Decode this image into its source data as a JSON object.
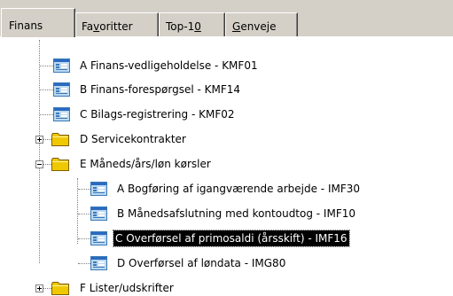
{
  "tabs": [
    {
      "label_parts": [
        "Finans"
      ],
      "active": true
    },
    {
      "label_parts": [
        "Fa",
        "v",
        "oritter"
      ],
      "active": false
    },
    {
      "label_parts": [
        "Top-1",
        "0",
        ""
      ],
      "active": false
    },
    {
      "label_parts": [
        "",
        "G",
        "enveje"
      ],
      "active": false
    }
  ],
  "tree": {
    "items": [
      {
        "label": "A Finans-vedligeholdelse - KMF01",
        "type": "program",
        "level": 0
      },
      {
        "label": "B Finans-forespørgsel - KMF14",
        "type": "program",
        "level": 0
      },
      {
        "label": "C Bilags-registrering - KMF02",
        "type": "program",
        "level": 0
      },
      {
        "label": "D Servicekontrakter",
        "type": "folder",
        "level": 0,
        "expanded": false
      },
      {
        "label": "E Måneds/års/løn kørsler",
        "type": "folder",
        "level": 0,
        "expanded": true
      },
      {
        "label": "A Bogføring af igangværende arbejde - IMF30",
        "type": "program",
        "level": 1
      },
      {
        "label": "B Månedsafslutning med kontoudtog - IMF10",
        "type": "program",
        "level": 1
      },
      {
        "label": "C Overførsel af primosaldi (årsskift) - IMF16",
        "type": "program",
        "level": 1,
        "selected": true
      },
      {
        "label": "D Overførsel af løndata - IMG80",
        "type": "program",
        "level": 1
      },
      {
        "label": "F Lister/udskrifter",
        "type": "folder",
        "level": 0,
        "expanded": false
      }
    ]
  },
  "colors": {
    "window_bg": "#d4d0c8",
    "panel_bg": "#ffffff",
    "folder": "#f0c800",
    "selection_bg": "#000000",
    "selection_fg": "#ffffff"
  },
  "icons": {
    "program": "program-window-icon",
    "folder": "folder-icon",
    "expand": "plus-box-icon",
    "collapse": "minus-box-icon"
  }
}
